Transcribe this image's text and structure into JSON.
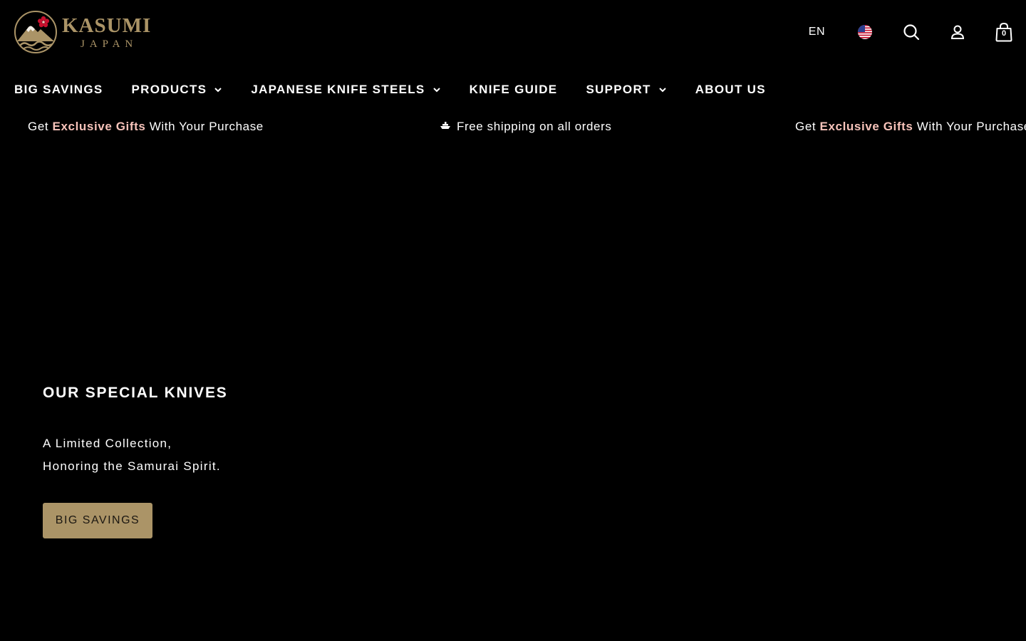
{
  "brand": {
    "name": "KASUMI",
    "sub": "JAPAN",
    "gold": "#ab9467"
  },
  "header": {
    "language": "EN",
    "cart_count": "0",
    "icons": [
      "us-flag-icon",
      "search-icon",
      "account-icon",
      "cart-icon"
    ]
  },
  "nav": {
    "items": [
      {
        "label": "BIG SAVINGS",
        "dropdown": false
      },
      {
        "label": "PRODUCTS",
        "dropdown": true
      },
      {
        "label": "JAPANESE KNIFE STEELS",
        "dropdown": true
      },
      {
        "label": "KNIFE GUIDE",
        "dropdown": false
      },
      {
        "label": "SUPPORT",
        "dropdown": true
      },
      {
        "label": "ABOUT US",
        "dropdown": false
      }
    ]
  },
  "announcement": {
    "gift": {
      "pre": "Get ",
      "highlight": "Exclusive Gifts",
      "post": " With Your Purchase"
    },
    "shipping": "Free shipping on all orders",
    "highlight_color": "#f7c3ba"
  },
  "hero": {
    "title": "OUR SPECIAL KNIVES",
    "line1": "A Limited Collection,",
    "line2": "Honoring the Samurai Spirit.",
    "button": "BIG SAVINGS"
  }
}
